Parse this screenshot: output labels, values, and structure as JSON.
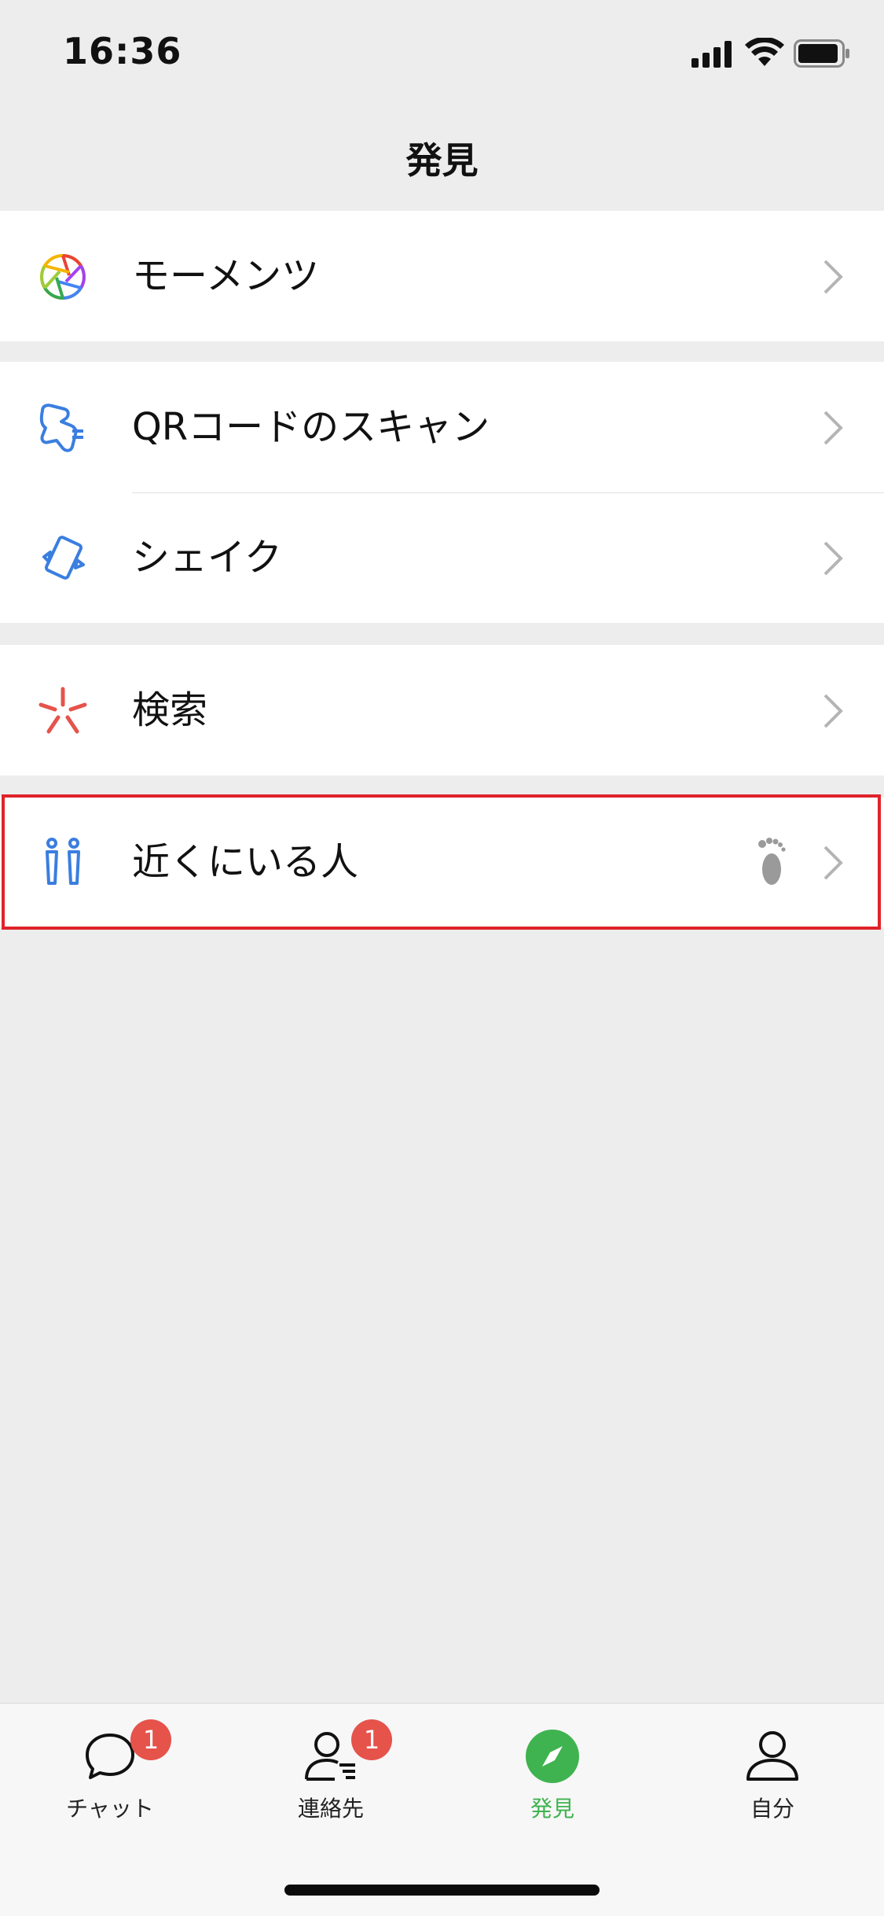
{
  "status_bar": {
    "time": "16:36"
  },
  "nav": {
    "title": "発見"
  },
  "menu": {
    "moments": "モーメンツ",
    "scan": "QRコードのスキャン",
    "shake": "シェイク",
    "search": "検索",
    "nearby": "近くにいる人"
  },
  "tabs": [
    {
      "label": "チャット",
      "badge": "1",
      "icon": "chat-bubble-icon"
    },
    {
      "label": "連絡先",
      "badge": "1",
      "icon": "contacts-icon"
    },
    {
      "label": "発見",
      "icon": "compass-icon",
      "active": true
    },
    {
      "label": "自分",
      "icon": "person-icon"
    }
  ],
  "colors": {
    "accent": "#3fb34f",
    "badge": "#e5534b",
    "highlight": "#e0232a",
    "icon_blue": "#3a7ee0",
    "icon_red": "#e5534b"
  }
}
